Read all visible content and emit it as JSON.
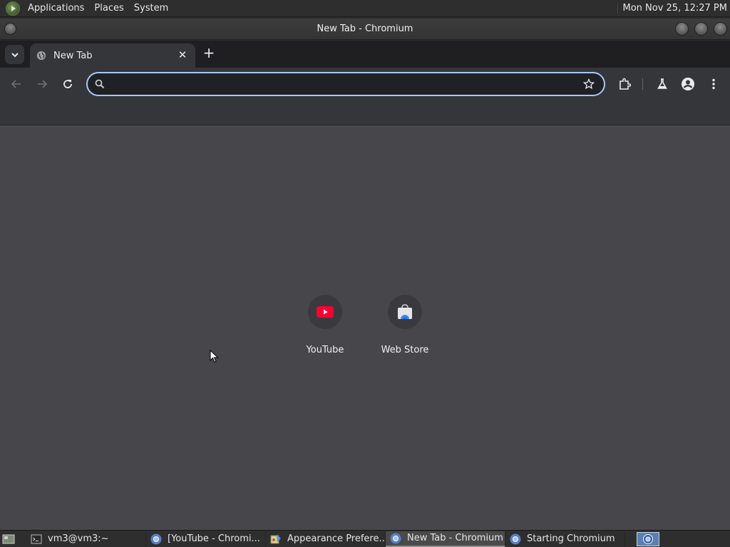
{
  "top_panel": {
    "menus": [
      "Applications",
      "Places",
      "System"
    ],
    "clock": "Mon Nov 25, 12:27 PM"
  },
  "window": {
    "title": "New Tab - Chromium"
  },
  "browser": {
    "tab": {
      "title": "New Tab"
    },
    "omnibox": {
      "value": "",
      "placeholder": ""
    },
    "icons": [
      "back-icon",
      "forward-icon",
      "reload-icon",
      "bookmark-star-icon",
      "extensions-icon",
      "labs-icon",
      "profile-icon",
      "menu-icon"
    ]
  },
  "new_tab_page": {
    "shortcuts": [
      {
        "label": "YouTube",
        "icon": "youtube-icon"
      },
      {
        "label": "Web Store",
        "icon": "web-store-icon"
      }
    ]
  },
  "taskbar": {
    "tasks": [
      {
        "label": "vm3@vm3:~",
        "icon": "terminal-icon",
        "active": false
      },
      {
        "label": "[YouTube - Chromi...",
        "icon": "chromium-icon",
        "active": false
      },
      {
        "label": "Appearance Prefere...",
        "icon": "appearance-icon",
        "active": false
      },
      {
        "label": "New Tab - Chromium",
        "icon": "chromium-icon",
        "active": true
      },
      {
        "label": "Starting Chromium",
        "icon": "chromium-icon",
        "active": false
      }
    ]
  },
  "colors": {
    "accent": "#a8c7fa",
    "page_background": "#46464b",
    "toolbar": "#35363a",
    "youtube_red": "#ff0033"
  }
}
